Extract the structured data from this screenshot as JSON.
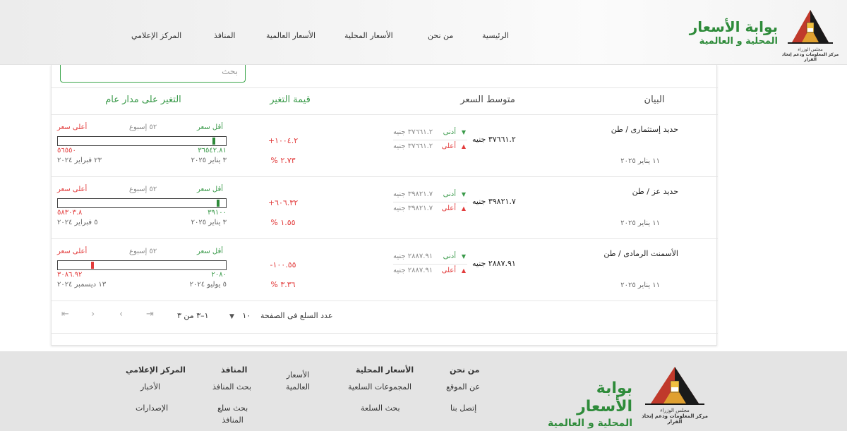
{
  "header": {
    "brand_line1": "بوابة الأسعار",
    "brand_line2": "المحلية و العالمية",
    "logo_caption1": "مجلس الوزراء",
    "logo_caption2": "مركز المعلومات ودعم إتخاذ القرار",
    "nav": [
      "الرئيسية",
      "من نحن",
      "الأسعار المحلية",
      "الأسعار العالمية",
      "المنافذ",
      "المركز الإعلامي"
    ]
  },
  "search": {
    "placeholder": "بحث"
  },
  "columns": {
    "item": "البيان",
    "avg": "متوسط السعر",
    "change_value": "قيمة التغير",
    "yearly": "التغير على مدار عام"
  },
  "labels": {
    "low": "أدنى",
    "high": "أعلى",
    "lowest_price": "أقل سعر",
    "highest_price": "أعلى سعر",
    "week52": "٥٢ إسبوع"
  },
  "rows": [
    {
      "name": "حديد إستثمارى / طن",
      "date": "١١ يناير ٢٠٢٥",
      "avg": "٣٧٦٦١.٢ جنيه",
      "low": "٣٧٦٦١.٢ جنيه",
      "high": "٣٧٦٦١.٢ جنيه",
      "change_amount": "+١٠٠٤.٢",
      "change_percent": "% ٢.٧٣",
      "min_price": "٣٦٥٤٢.٨١",
      "min_date": "٣ يناير ٢٠٢٥",
      "max_price": "٥٦٥٥٠",
      "max_date": "٢٣ فبراير ٢٠٢٤",
      "position": 0.065,
      "marker_color": "#2e8b3a"
    },
    {
      "name": "حديد عز / طن",
      "date": "١١ يناير ٢٠٢٥",
      "avg": "٣٩٨٢١.٧ جنيه",
      "low": "٣٩٨٢١.٧ جنيه",
      "high": "٣٩٨٢١.٧ جنيه",
      "change_amount": "+٦٠٦.٣٢",
      "change_percent": "% ١.٥٥",
      "min_price": "٣٩١٠٠",
      "min_date": "٣ يناير ٢٠٢٥",
      "max_price": "٥٨٣٠٣.٨",
      "max_date": "٥ فبراير ٢٠٢٤",
      "position": 0.04,
      "marker_color": "#2e8b3a"
    },
    {
      "name": "الأسمنت الرمادى / طن",
      "date": "١١ يناير ٢٠٢٥",
      "avg": "٢٨٨٧.٩١ جنيه",
      "low": "٢٨٨٧.٩١ جنيه",
      "high": "٢٨٨٧.٩١ جنيه",
      "change_amount": "-١٠٠.٥٥",
      "change_percent": "% ٣.٣٦",
      "min_price": "٢٠٨٠",
      "min_date": "٥ يوليو ٢٠٢٤",
      "max_price": "٣٠٨٦.٩٢",
      "max_date": "١٣ ديسمبر ٢٠٢٤",
      "position": 0.8,
      "marker_color": "#e23b3b"
    }
  ],
  "pagination": {
    "per_page_label": "عدد السلع فى الصفحة",
    "per_page_value": "١٠",
    "range": "١–٣ من ٣"
  },
  "footer": {
    "brand_line1": "بوابة الأسعار",
    "brand_line2": "المحلية و العالمية",
    "logo_caption1": "مجلس الوزراء",
    "logo_caption2": "مركز المعلومات ودعم إتخاذ القرار",
    "about": {
      "title": "من نحن",
      "links": [
        "عن الموقع",
        "إتصل بنا"
      ]
    },
    "local": {
      "title": "الأسعار المحلية",
      "links": [
        "المجموعات السلعية",
        "بحث السلعة"
      ]
    },
    "global": {
      "line1": "الأسعار",
      "line2": "العالمية"
    },
    "outlets": {
      "title": "المنافذ",
      "link1": "بحث المنافذ",
      "link2a": "بحث سلع",
      "link2b": "المنافذ"
    },
    "media": {
      "title": "المركز الإعلامي",
      "links": [
        "الأخبار",
        "الإصدارات"
      ]
    }
  },
  "colors": {
    "green": "#3a9a4a",
    "red": "#e23b3b",
    "brand_green": "#2e8b3a",
    "footer_bg": "#e4e4e4"
  }
}
